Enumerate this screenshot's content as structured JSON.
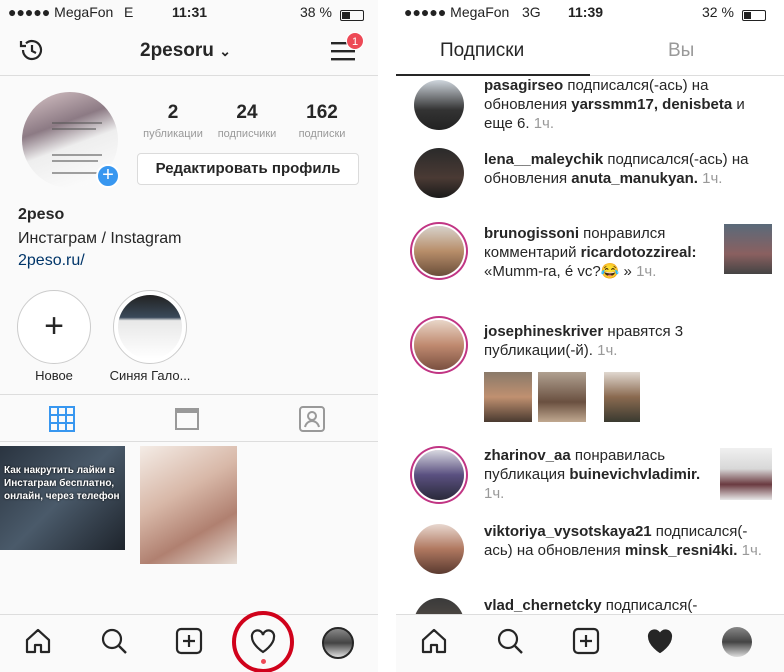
{
  "left": {
    "status": {
      "carrier": "●●●●● MegaFon",
      "network": "E",
      "time": "11:31",
      "battery": "38 %"
    },
    "header": {
      "username": "2pesoru",
      "notif_count": "1"
    },
    "profile": {
      "stats": [
        {
          "num": "2",
          "label": "публикации"
        },
        {
          "num": "24",
          "label": "подписчики"
        },
        {
          "num": "162",
          "label": "подписки"
        }
      ],
      "edit_label": "Редактировать профиль",
      "name": "2peso",
      "bio": "Инстаграм / Instagram",
      "link": "2peso.ru/"
    },
    "highlights": [
      {
        "label": "Новое"
      },
      {
        "label": "Синяя Гало..."
      }
    ],
    "post1_text": "Как накрутить лайки в Инстаграм бесплатно, онлайн, через телефон"
  },
  "right": {
    "status": {
      "carrier": "●●●●● MegaFon",
      "network": "3G",
      "time": "11:39",
      "battery": "32 %"
    },
    "tabs": [
      "Подписки",
      "Вы"
    ],
    "feed": [
      {
        "user": "pasagirseo",
        "text": "подписался(-ась) на обновления",
        "targets": "yarssmm17, denisbeta",
        "tail": "и еще 6.",
        "time": "1ч."
      },
      {
        "user": "lena__maleychik",
        "text": "подписался(-ась) на обновления",
        "targets": "anuta_manukyan.",
        "time": "1ч."
      },
      {
        "user": "brunogissoni",
        "text": "понравился комментарий",
        "targets": "ricardotozzireal:",
        "tail": "«Mumm-ra, é vc?😂 »",
        "time": "1ч."
      },
      {
        "user": "josephineskriver",
        "text": "нравятся 3 публикации(-й).",
        "time": "1ч."
      },
      {
        "user": "zharinov_aa",
        "text": "понравилась публикация",
        "targets": "buinevichvladimir.",
        "time": "1ч."
      },
      {
        "user": "viktoriya_vysotskaya21",
        "text": "подписался(-ась) на обновления",
        "targets": "minsk_resni4ki.",
        "time": "1ч."
      },
      {
        "user": "vlad_chernetcky",
        "text": "подписался(-"
      }
    ]
  },
  "colors": {
    "accent": "#3897f0",
    "badge": "#ed4956",
    "highlight_red": "#d0021b"
  }
}
